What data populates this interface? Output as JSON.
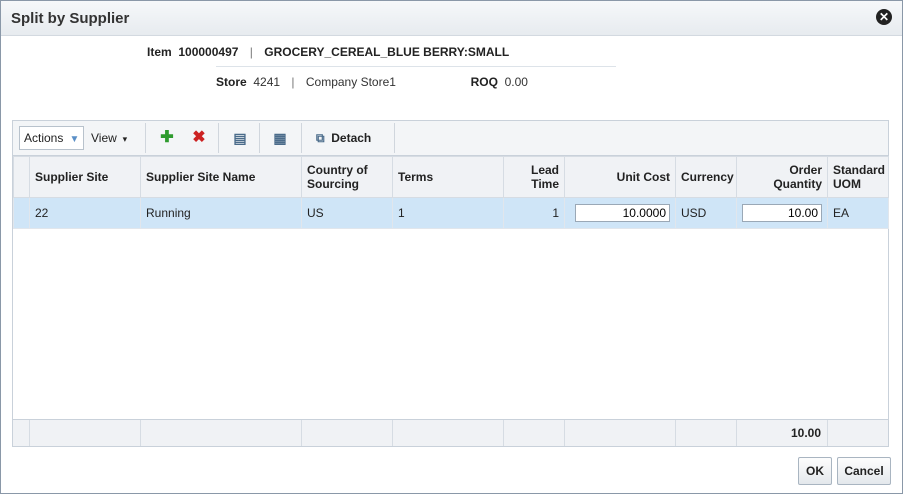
{
  "dialog": {
    "title": "Split by Supplier"
  },
  "header": {
    "item_label": "Item",
    "item_value": "100000497",
    "item_desc": "GROCERY_CEREAL_BLUE BERRY:SMALL",
    "store_label": "Store",
    "store_value": "4241",
    "store_name": "Company Store1",
    "roq_label": "ROQ",
    "roq_value": "0.00"
  },
  "toolbar": {
    "actions_label": "Actions",
    "view_label": "View",
    "detach_label": "Detach"
  },
  "columns": {
    "supplier_site": "Supplier Site",
    "supplier_site_name": "Supplier Site Name",
    "country_line1": "Country of",
    "country_line2": "Sourcing",
    "terms": "Terms",
    "lead_line1": "Lead",
    "lead_line2": "Time",
    "unit_cost": "Unit Cost",
    "currency": "Currency",
    "order_line1": "Order",
    "order_line2": "Quantity",
    "uom_line1": "Standard",
    "uom_line2": "UOM"
  },
  "rows": [
    {
      "supplier_site": "22",
      "supplier_site_name": "Running",
      "country": "US",
      "terms": "1",
      "lead_time": "1",
      "unit_cost": "10.0000",
      "currency": "USD",
      "order_quantity": "10.00",
      "uom": "EA"
    }
  ],
  "footer": {
    "order_quantity_total": "10.00"
  },
  "buttons": {
    "ok": "OK",
    "cancel": "Cancel"
  },
  "colors": {
    "selected_row": "#cfe5f7",
    "add_icon": "#2e9b2e",
    "delete_icon": "#cc2222"
  }
}
